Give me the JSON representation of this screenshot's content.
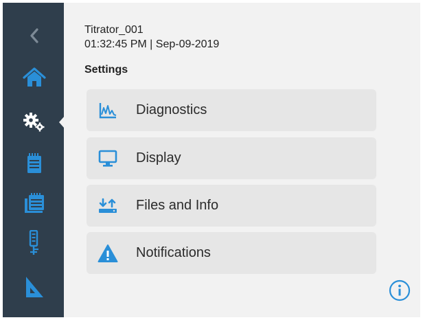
{
  "header": {
    "device_name": "Titrator_001",
    "datetime": "01:32:45 PM | Sep-09-2019"
  },
  "section": {
    "title": "Settings"
  },
  "sidebar": {
    "items": [
      {
        "icon": "chevron-left-icon"
      },
      {
        "icon": "home-icon"
      },
      {
        "icon": "gears-icon",
        "active": true
      },
      {
        "icon": "notepad-icon"
      },
      {
        "icon": "folders-icon"
      },
      {
        "icon": "electrode-icon"
      },
      {
        "icon": "ruler-triangle-icon"
      }
    ]
  },
  "menu": {
    "items": [
      {
        "label": "Diagnostics",
        "icon": "chart-icon"
      },
      {
        "label": "Display",
        "icon": "monitor-icon"
      },
      {
        "label": "Files and Info",
        "icon": "transfer-icon"
      },
      {
        "label": "Notifications",
        "icon": "warning-icon"
      }
    ]
  },
  "colors": {
    "sidebar_bg": "#2f3e4c",
    "accent": "#2a8fd8",
    "content_bg": "#f2f2f2",
    "tile_bg": "#e6e6e6"
  }
}
